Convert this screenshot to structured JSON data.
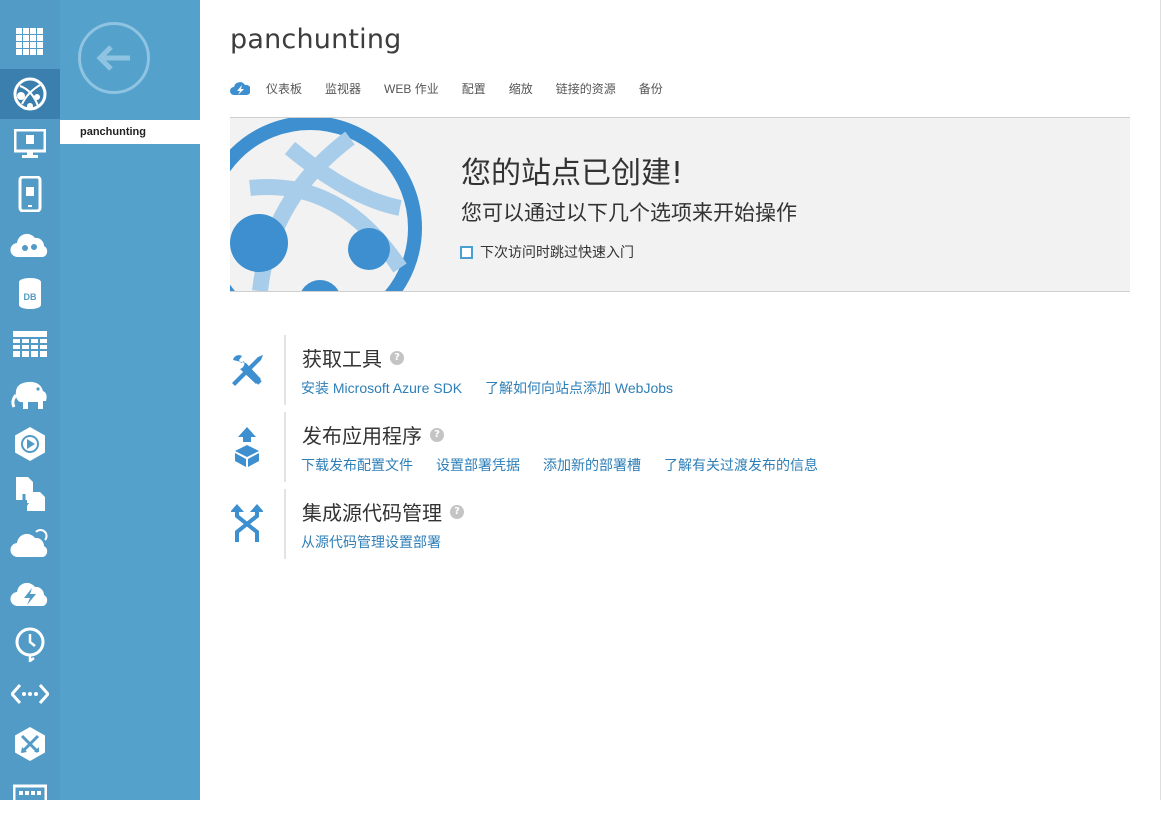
{
  "site": {
    "name": "panchunting"
  },
  "subnav": {
    "selected_item": "panchunting"
  },
  "tabs": [
    {
      "label": "仪表板"
    },
    {
      "label": "监视器"
    },
    {
      "label": "WEB 作业"
    },
    {
      "label": "配置"
    },
    {
      "label": "缩放"
    },
    {
      "label": "链接的资源"
    },
    {
      "label": "备份"
    }
  ],
  "banner": {
    "title": "您的站点已创建!",
    "subtitle": "您可以通过以下几个选项来开始操作",
    "skip_label": "下次访问时跳过快速入门",
    "skip_checked": false
  },
  "sections": [
    {
      "icon": "tools-icon",
      "title": "获取工具",
      "help": "?",
      "links": [
        "安装 Microsoft Azure SDK",
        "了解如何向站点添加 WebJobs"
      ]
    },
    {
      "icon": "publish-icon",
      "title": "发布应用程序",
      "help": "?",
      "links": [
        "下载发布配置文件",
        "设置部署凭据",
        "添加新的部署槽",
        "了解有关过渡发布的信息"
      ]
    },
    {
      "icon": "source-control-icon",
      "title": "集成源代码管理",
      "help": "?",
      "links": [
        "从源代码管理设置部署"
      ]
    }
  ],
  "rail": [
    {
      "icon": "all-items-grid-icon"
    },
    {
      "icon": "websites-icon",
      "active": true
    },
    {
      "icon": "virtual-machines-icon"
    },
    {
      "icon": "mobile-services-icon"
    },
    {
      "icon": "cloud-services-icon"
    },
    {
      "icon": "sql-databases-icon"
    },
    {
      "icon": "storage-icon"
    },
    {
      "icon": "hdinsight-icon"
    },
    {
      "icon": "media-services-icon"
    },
    {
      "icon": "service-bus-icon"
    },
    {
      "icon": "cloud-icon"
    },
    {
      "icon": "cache-icon"
    },
    {
      "icon": "scheduler-icon"
    },
    {
      "icon": "networks-icon"
    },
    {
      "icon": "traffic-manager-icon"
    },
    {
      "icon": "management-services-icon"
    }
  ],
  "colors": {
    "rail": "#519bc6",
    "rail_active": "#3a7fae",
    "subnav": "#54a1cc",
    "link": "#2e7fb8",
    "accent": "#3d8fcf"
  }
}
